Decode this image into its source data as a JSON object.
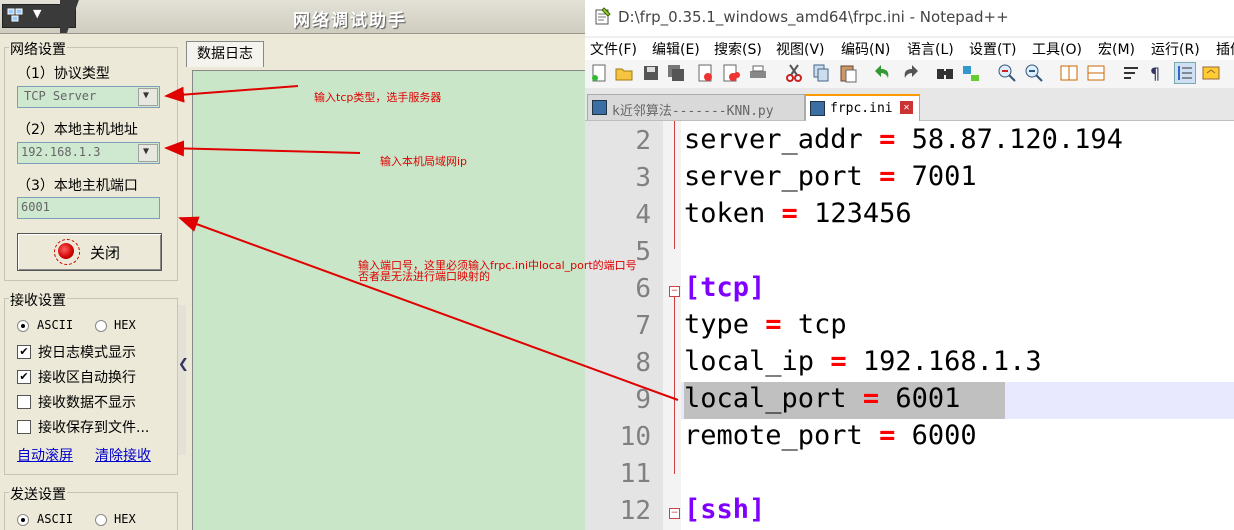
{
  "left_app": {
    "title": "网络调试助手",
    "network_settings": {
      "group_label": "网络设置",
      "protocol_label": "（1）协议类型",
      "protocol_value": "TCP Server",
      "host_label": "（2）本地主机地址",
      "host_value": "192.168.1.3",
      "port_label": "（3）本地主机端口",
      "port_value": "6001",
      "close_button": "关闭"
    },
    "receive_settings": {
      "group_label": "接收设置",
      "ascii": "ASCII",
      "hex": "HEX",
      "log_mode": "按日志模式显示",
      "auto_wrap": "接收区自动换行",
      "hide_data": "接收数据不显示",
      "save_to_file": "接收保存到文件...",
      "auto_scroll": "自动滚屏",
      "clear_receive": "清除接收"
    },
    "send_settings": {
      "group_label": "发送设置",
      "ascii": "ASCII",
      "hex": "HEX"
    },
    "log_tab": "数据日志"
  },
  "notepad": {
    "title": "D:\\frp_0.35.1_windows_amd64\\frpc.ini - Notepad++",
    "menu": [
      "文件(F)",
      "编辑(E)",
      "搜索(S)",
      "视图(V)",
      "编码(N)",
      "语言(L)",
      "设置(T)",
      "工具(O)",
      "宏(M)",
      "运行(R)",
      "插件"
    ],
    "tabs": [
      {
        "name": "k近邻算法-------KNN.py"
      },
      {
        "name": "frpc.ini"
      }
    ],
    "lines": [
      {
        "num": "2",
        "key": "server_addr",
        "eq": "=",
        "val": "58.87.120.194"
      },
      {
        "num": "3",
        "key": "server_port",
        "eq": "=",
        "val": "7001"
      },
      {
        "num": "4",
        "key": "token",
        "eq": "=",
        "val": "123456"
      },
      {
        "num": "5"
      },
      {
        "num": "6",
        "section": "[tcp]"
      },
      {
        "num": "7",
        "key": "type",
        "eq": "=",
        "val": "tcp"
      },
      {
        "num": "8",
        "key": "local_ip",
        "eq": "=",
        "val": "192.168.1.3"
      },
      {
        "num": "9",
        "key": "local_port",
        "eq": "=",
        "val": "6001"
      },
      {
        "num": "10",
        "key": "remote_port",
        "eq": "=",
        "val": "6000"
      },
      {
        "num": "11"
      },
      {
        "num": "12",
        "section": "[ssh]"
      }
    ]
  },
  "annotations": {
    "note_protocol": "输入tcp类型，选手服务器",
    "note_ip": "输入本机局域网ip",
    "note_port_line1": "输入端口号，这里必须输入frpc.ini中local_port的端口号",
    "note_port_line2": "否者是无法进行端口映射的",
    "color": "#e00000"
  },
  "colors": {
    "log_background": "#c9e6c9",
    "combo_background": "#cfe8d0",
    "npp_equals": "#ff0000",
    "npp_section": "#8000ff"
  }
}
